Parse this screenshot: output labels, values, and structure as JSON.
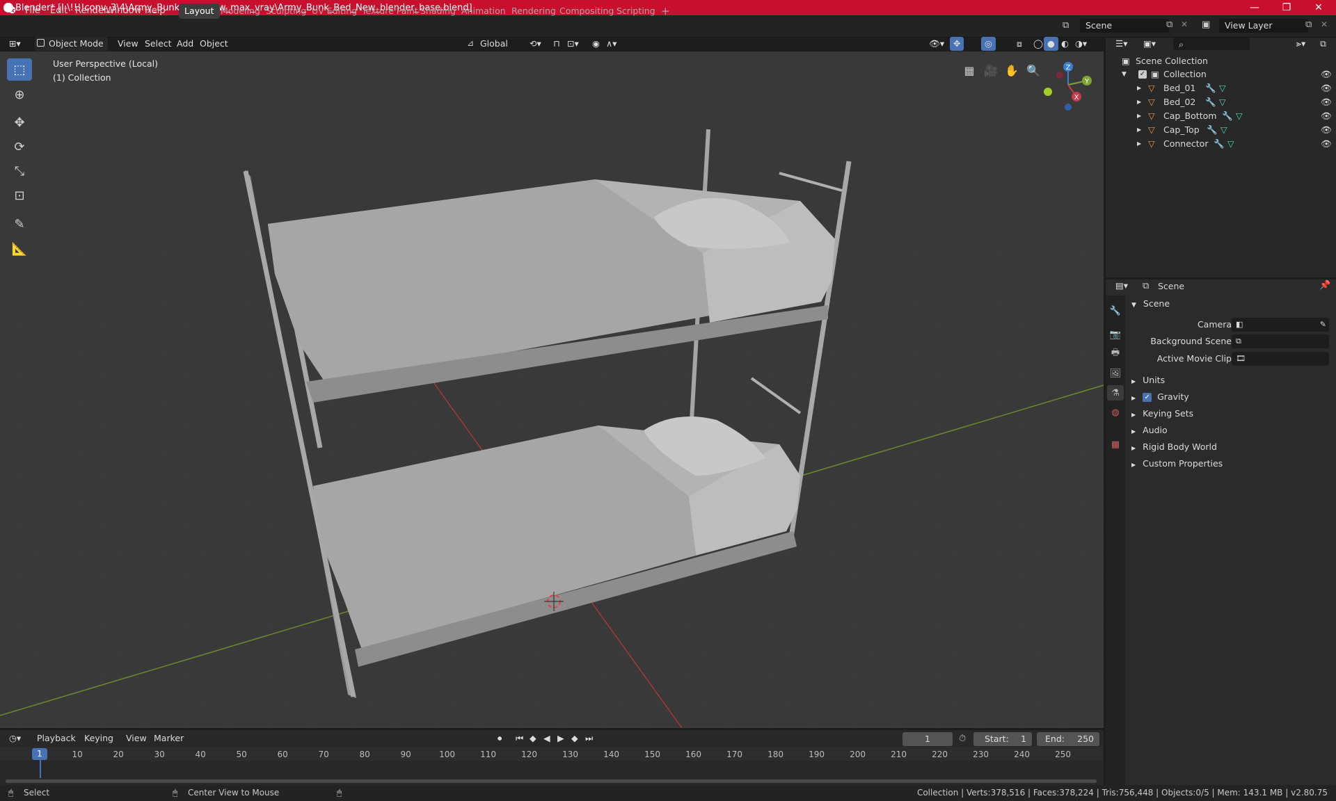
{
  "window": {
    "title": "Blender* [I:\\!!!!conv_3\\4\\Army_Bunk_Bed_New_max_vray\\Army_Bunk_Bed_New_blender_base.blend]",
    "minimize": "—",
    "maximize": "❐",
    "close": "✕"
  },
  "menu": [
    "File",
    "Edit",
    "Render",
    "Window",
    "Help"
  ],
  "workspaces": [
    "Layout",
    "Modeling",
    "Sculpting",
    "UV Editing",
    "Texture Paint",
    "Shading",
    "Animation",
    "Rendering",
    "Compositing",
    "Scripting"
  ],
  "workspace_add": "+",
  "scene_field": "Scene",
  "view_layer_field": "View Layer",
  "viewport_header": {
    "mode": "Object Mode",
    "view": "View",
    "select": "Select",
    "add": "Add",
    "object": "Object",
    "orientation": "Global"
  },
  "viewport": {
    "perspective_label": "User Perspective (Local)",
    "collection_label": "(1) Collection",
    "gizmo": {
      "z": "Z",
      "y": "Y",
      "x": "X"
    }
  },
  "outliner": {
    "root": "Scene Collection",
    "collection": "Collection",
    "objects": [
      "Bed_01",
      "Bed_02",
      "Cap_Bottom",
      "Cap_Top",
      "Connector"
    ]
  },
  "properties": {
    "header": "Scene",
    "section": "Scene",
    "camera_label": "Camera",
    "background_scene_label": "Background Scene",
    "active_movie_clip_label": "Active Movie Clip",
    "subpanels": [
      "Units",
      "Gravity",
      "Keying Sets",
      "Audio",
      "Rigid Body World",
      "Custom Properties"
    ],
    "gravity_checked": true
  },
  "timeline": {
    "playback": "Playback",
    "keying": "Keying",
    "view": "View",
    "marker": "Marker",
    "current_frame": "1",
    "start_label": "Start:",
    "start_value": "1",
    "end_label": "End:",
    "end_value": "250",
    "ticks": [
      "1",
      "10",
      "20",
      "30",
      "40",
      "50",
      "60",
      "70",
      "80",
      "90",
      "100",
      "110",
      "120",
      "130",
      "140",
      "150",
      "160",
      "170",
      "180",
      "190",
      "200",
      "210",
      "220",
      "230",
      "240",
      "250"
    ]
  },
  "status": {
    "left_action": "Select",
    "middle_action": "Center View to Mouse",
    "stats": "Collection | Verts:378,516 | Faces:378,224 | Tris:756,448 | Objects:0/5 | Mem: 143.1 MB | v2.80.75"
  },
  "colors": {
    "titlebar": "#c8102e",
    "accent": "#4772b3",
    "viewport_bg": "#393939",
    "object_icon": "#e89a3c",
    "modifier_icon": "#6d9de6",
    "mesh_icon": "#3fd9b5"
  }
}
